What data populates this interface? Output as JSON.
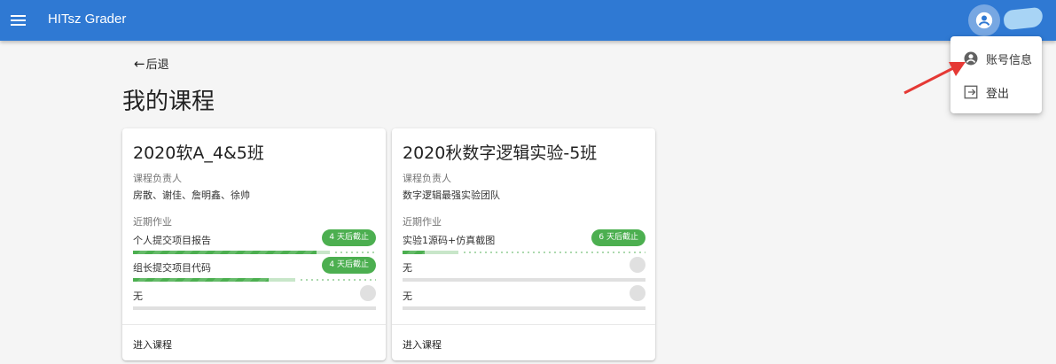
{
  "app": {
    "title": "HITsz Grader"
  },
  "user_menu": {
    "items": [
      {
        "label": "账号信息",
        "icon": "account-circle-icon"
      },
      {
        "label": "登出",
        "icon": "logout-icon"
      }
    ]
  },
  "nav": {
    "back_arrow": "←",
    "back_label": "后退"
  },
  "page": {
    "title": "我的课程"
  },
  "courses": [
    {
      "title": "2020软A_4&5班",
      "owner_label": "课程负责人",
      "owners": "房散、谢佳、詹明鑫、徐帅",
      "recent_label": "近期作业",
      "assignments": [
        {
          "name": "个人提交项目报告",
          "deadline": "4 天后截止",
          "progress": 0.76,
          "buffer": 0.81
        },
        {
          "name": "组长提交项目代码",
          "deadline": "4 天后截止",
          "progress": 0.56,
          "buffer": 0.67
        },
        {
          "name": "无",
          "deadline": "",
          "progress": 0,
          "buffer": 0
        }
      ],
      "enter_label": "进入课程"
    },
    {
      "title": "2020秋数字逻辑实验-5班",
      "owner_label": "课程负责人",
      "owners": "数字逻辑最强实验团队",
      "recent_label": "近期作业",
      "assignments": [
        {
          "name": "实验1源码+仿真截图",
          "deadline": "6 天后截止",
          "progress": 0.09,
          "buffer": 0.23
        },
        {
          "name": "无",
          "deadline": "",
          "progress": 0,
          "buffer": 0
        },
        {
          "name": "无",
          "deadline": "",
          "progress": 0,
          "buffer": 0
        }
      ],
      "enter_label": "进入课程"
    }
  ],
  "colors": {
    "appbar": "#2f79d3",
    "chip": "#4caf50",
    "arrow": "#e53935"
  }
}
